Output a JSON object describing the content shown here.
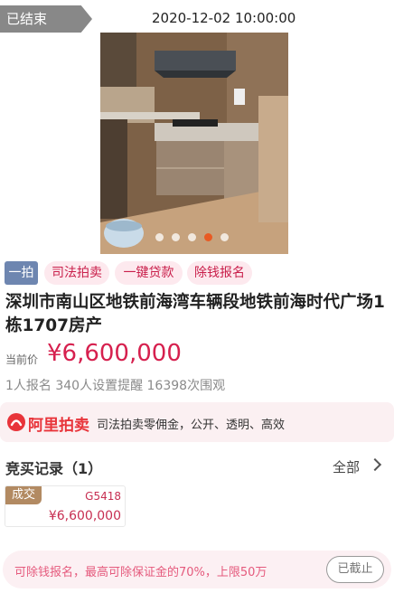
{
  "status": {
    "label": "已结束",
    "time": "2020-12-02 10:00:00"
  },
  "gallery": {
    "total": 5,
    "active_index": 3
  },
  "tags": {
    "one": "一拍",
    "judicial": "司法拍卖",
    "loan": "一键贷款",
    "deposit": "除钱报名"
  },
  "item": {
    "title": "深圳市南山区地铁前海湾车辆段地铁前海时代广场1栋1707房产"
  },
  "price": {
    "label": "当前价",
    "value": "¥6,600,000"
  },
  "stats": {
    "text": "1人报名  340人设置提醒  16398次围观"
  },
  "ali": {
    "brand": "阿里拍卖",
    "desc": "司法拍卖零佣金，公开、透明、高效"
  },
  "bids": {
    "title": "竞买记录（1）",
    "all_label": "全部",
    "records": [
      {
        "badge": "成交",
        "code": "G5418",
        "amount": "¥6,600,000"
      }
    ]
  },
  "notice": {
    "text": "可除钱报名，最高可除保证金的70%，上限50万",
    "button": "已截止"
  },
  "colors": {
    "accent": "#d6204e",
    "status_tag": "#888888",
    "dot_active": "#e85a23"
  }
}
